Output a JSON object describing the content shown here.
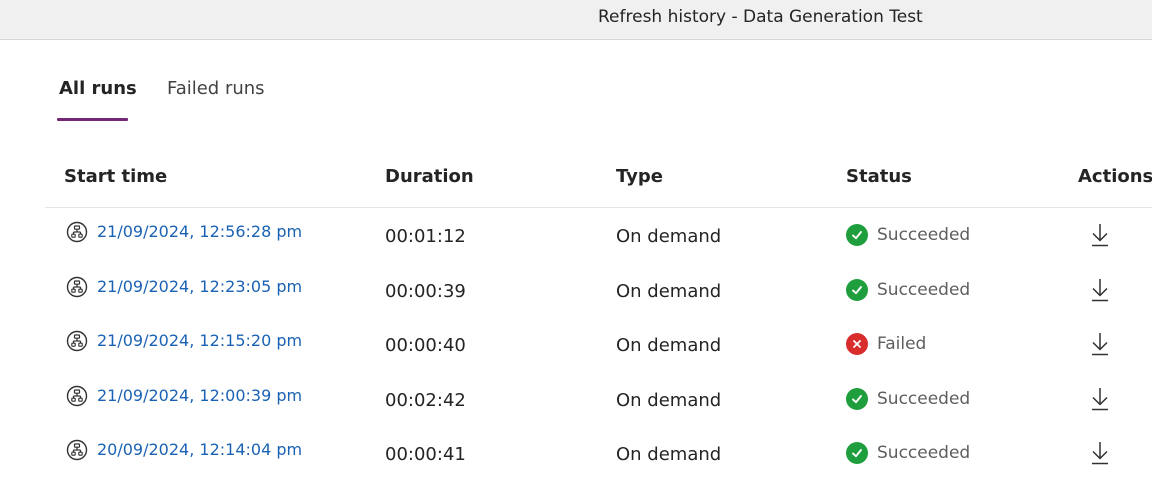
{
  "window": {
    "title": "Refresh history - Data Generation Test"
  },
  "tabs": [
    {
      "label": "All runs",
      "selected": true
    },
    {
      "label": "Failed runs",
      "selected": false
    }
  ],
  "table": {
    "columns": [
      "Start time",
      "Duration",
      "Type",
      "Status",
      "Actions"
    ],
    "rows": [
      {
        "start_time": "21/09/2024, 12:56:28 pm",
        "duration": "00:01:12",
        "type": "On demand",
        "status": "Succeeded",
        "status_icon": "success-check-icon"
      },
      {
        "start_time": "21/09/2024, 12:23:05 pm",
        "duration": "00:00:39",
        "type": "On demand",
        "status": "Succeeded",
        "status_icon": "success-check-icon"
      },
      {
        "start_time": "21/09/2024, 12:15:20 pm",
        "duration": "00:00:40",
        "type": "On demand",
        "status": "Failed",
        "status_icon": "failed-x-icon"
      },
      {
        "start_time": "21/09/2024, 12:00:39 pm",
        "duration": "00:02:42",
        "type": "On demand",
        "status": "Succeeded",
        "status_icon": "success-check-icon"
      },
      {
        "start_time": "20/09/2024, 12:14:04 pm",
        "duration": "00:00:41",
        "type": "On demand",
        "status": "Succeeded",
        "status_icon": "success-check-icon"
      }
    ]
  },
  "colors": {
    "accent": "#742774",
    "link": "#1a62b4",
    "success": "#1f9e3d",
    "failed": "#d92c2c"
  },
  "icons": {
    "run": "dataflow-run-icon",
    "download": "download-icon"
  }
}
